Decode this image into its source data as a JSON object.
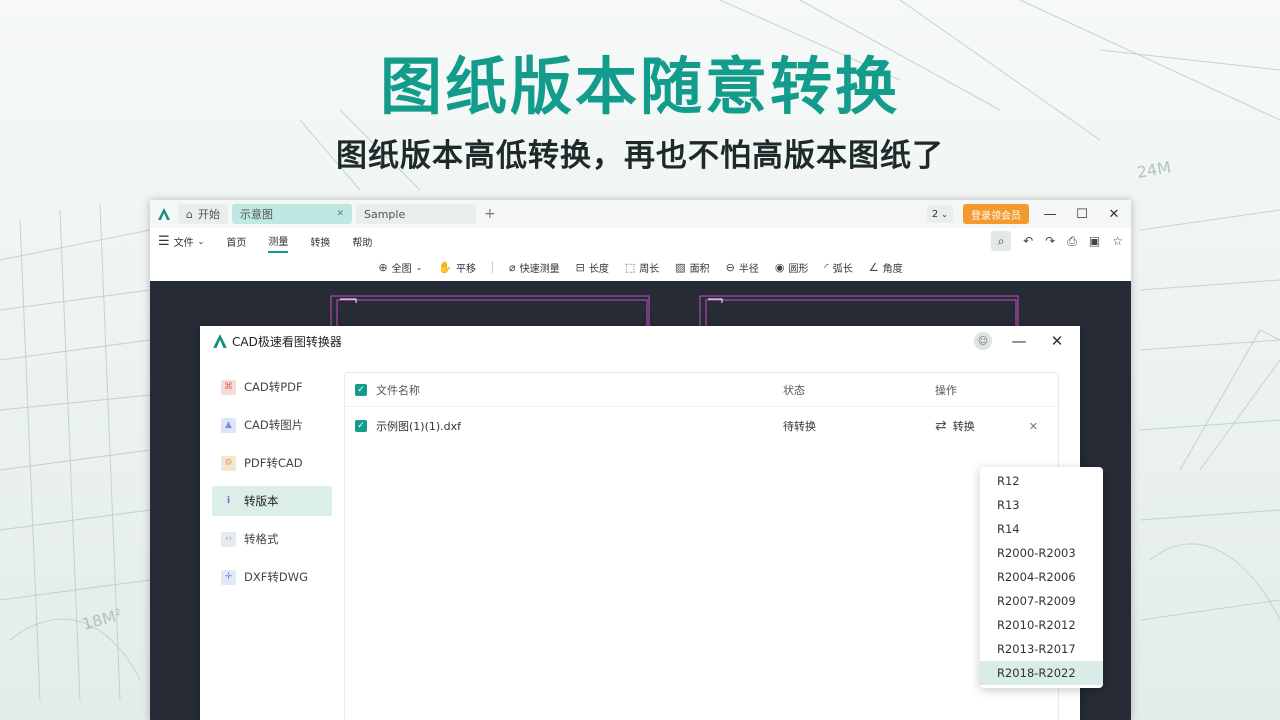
{
  "hero": {
    "title": "图纸版本随意转换",
    "subtitle": "图纸版本高低转换，再也不怕高版本图纸了"
  },
  "app": {
    "tabs": [
      {
        "label": "开始",
        "icon": "home-icon"
      },
      {
        "label": "示意图",
        "icon": "close-icon"
      },
      {
        "label": "Sample"
      }
    ],
    "page_selector": "2",
    "vip_button": "登录领会员",
    "menu": {
      "file": "文件",
      "items": [
        "首页",
        "测量",
        "转换",
        "帮助"
      ],
      "active": "测量"
    },
    "toolbar": [
      {
        "label": "全图",
        "icon": "zoom-all-icon"
      },
      {
        "label": "平移",
        "icon": "hand-icon"
      },
      {
        "label": "快速测量",
        "icon": "ruler-icon"
      },
      {
        "label": "长度",
        "icon": "length-icon"
      },
      {
        "label": "周长",
        "icon": "perimeter-icon"
      },
      {
        "label": "面积",
        "icon": "area-icon"
      },
      {
        "label": "半径",
        "icon": "radius-icon"
      },
      {
        "label": "圆形",
        "icon": "circle-icon"
      },
      {
        "label": "弧长",
        "icon": "arc-icon"
      },
      {
        "label": "角度",
        "icon": "angle-icon"
      }
    ]
  },
  "dialog": {
    "title": "CAD极速看图转换器",
    "sidebar": [
      {
        "label": "CAD转PDF",
        "color": "#e26b5b"
      },
      {
        "label": "CAD转图片",
        "color": "#7a8fd8"
      },
      {
        "label": "PDF转CAD",
        "color": "#e9a35a"
      },
      {
        "label": "转版本",
        "color": "#8a5cc8"
      },
      {
        "label": "转格式",
        "color": "#9aa4c8"
      },
      {
        "label": "DXF转DWG",
        "color": "#6a8fd8"
      }
    ],
    "active_item": "转版本",
    "table": {
      "headers": {
        "name": "文件名称",
        "status": "状态",
        "action": "操作"
      },
      "rows": [
        {
          "name": "示例图(1)(1).dxf",
          "status": "待转换",
          "action": "转换"
        }
      ]
    },
    "version_options": [
      "R12",
      "R13",
      "R14",
      "R2000-R2003",
      "R2004-R2006",
      "R2007-R2009",
      "R2010-R2012",
      "R2013-R2017",
      "R2018-R2022"
    ],
    "selected_version": "R2018-R2022"
  },
  "colors": {
    "brand": "#139c8c",
    "vip": "#f29a2e",
    "canvas": "#262b36"
  }
}
